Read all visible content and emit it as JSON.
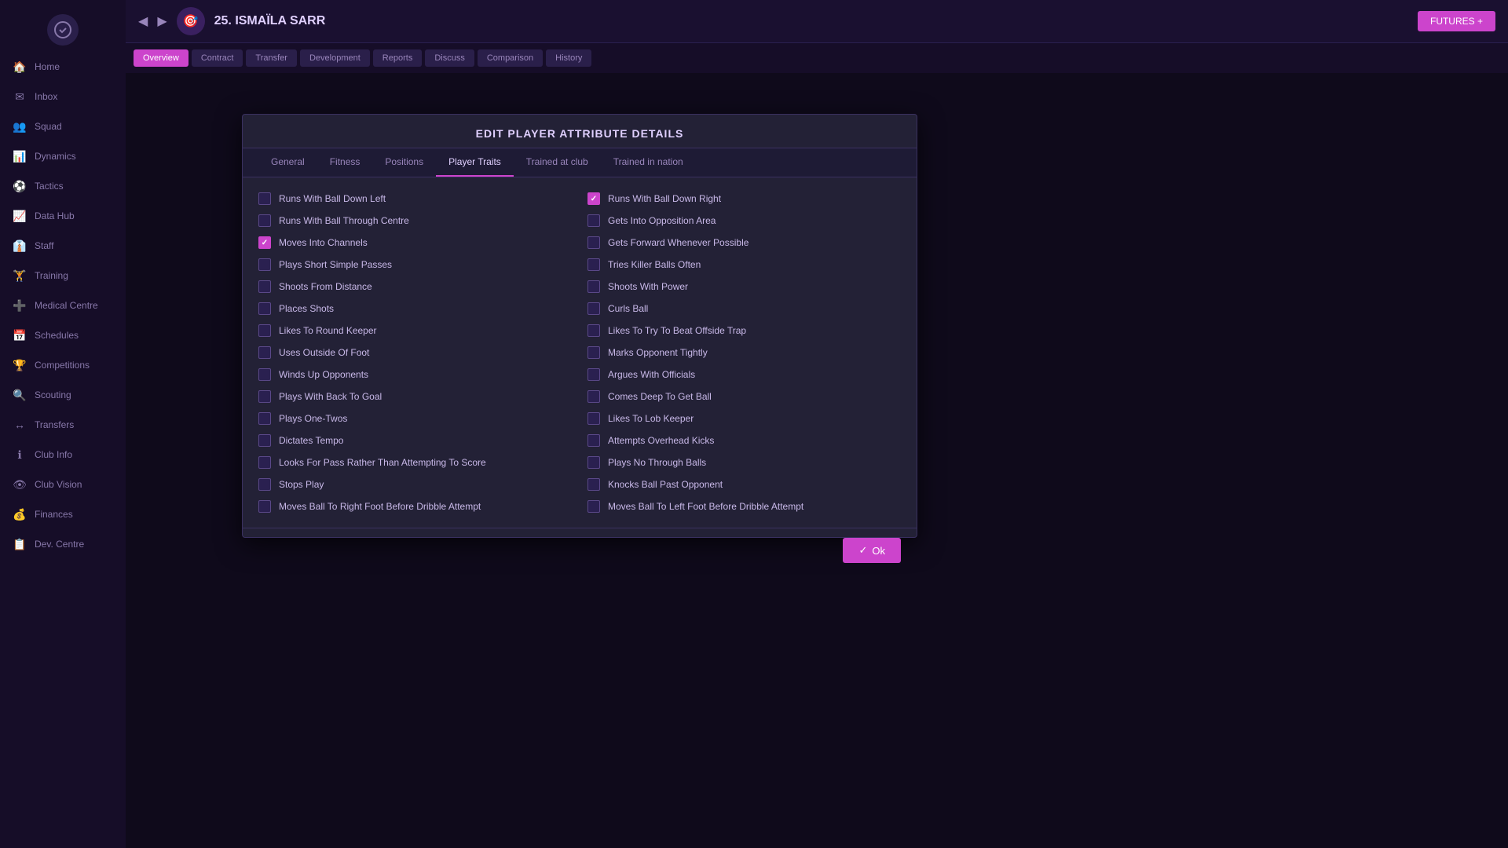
{
  "modal": {
    "title": "EDIT PLAYER ATTRIBUTE DETAILS",
    "ok_label": "Ok"
  },
  "tabs": [
    {
      "id": "general",
      "label": "General",
      "active": false
    },
    {
      "id": "fitness",
      "label": "Fitness",
      "active": false
    },
    {
      "id": "positions",
      "label": "Positions",
      "active": false
    },
    {
      "id": "player_traits",
      "label": "Player Traits",
      "active": true
    },
    {
      "id": "trained_at_club",
      "label": "Trained at club",
      "active": false
    },
    {
      "id": "trained_in_nation",
      "label": "Trained in nation",
      "active": false
    }
  ],
  "left_traits": [
    {
      "label": "Runs With Ball Down Left",
      "checked": false
    },
    {
      "label": "Runs With Ball Through Centre",
      "checked": false
    },
    {
      "label": "Moves Into Channels",
      "checked": true
    },
    {
      "label": "Plays Short Simple Passes",
      "checked": false
    },
    {
      "label": "Shoots From Distance",
      "checked": false
    },
    {
      "label": "Places Shots",
      "checked": false
    },
    {
      "label": "Likes To Round Keeper",
      "checked": false
    },
    {
      "label": "Uses Outside Of Foot",
      "checked": false
    },
    {
      "label": "Winds Up Opponents",
      "checked": false
    },
    {
      "label": "Plays With Back To Goal",
      "checked": false
    },
    {
      "label": "Plays One-Twos",
      "checked": false
    },
    {
      "label": "Dictates Tempo",
      "checked": false
    },
    {
      "label": "Looks For Pass Rather Than Attempting To Score",
      "checked": false
    },
    {
      "label": "Stops Play",
      "checked": false
    },
    {
      "label": "Moves Ball To Right Foot Before Dribble Attempt",
      "checked": false
    }
  ],
  "right_traits": [
    {
      "label": "Runs With Ball Down Right",
      "checked": true
    },
    {
      "label": "Gets Into Opposition Area",
      "checked": false
    },
    {
      "label": "Gets Forward Whenever Possible",
      "checked": false
    },
    {
      "label": "Tries Killer Balls Often",
      "checked": false
    },
    {
      "label": "Shoots With Power",
      "checked": false
    },
    {
      "label": "Curls Ball",
      "checked": false
    },
    {
      "label": "Likes To Try To Beat Offside Trap",
      "checked": false
    },
    {
      "label": "Marks Opponent Tightly",
      "checked": false
    },
    {
      "label": "Argues With Officials",
      "checked": false
    },
    {
      "label": "Comes Deep To Get Ball",
      "checked": false
    },
    {
      "label": "Likes To Lob Keeper",
      "checked": false
    },
    {
      "label": "Attempts Overhead Kicks",
      "checked": false
    },
    {
      "label": "Plays No Through Balls",
      "checked": false
    },
    {
      "label": "Knocks Ball Past Opponent",
      "checked": false
    },
    {
      "label": "Moves Ball To Left Foot Before Dribble Attempt",
      "checked": false
    }
  ],
  "sidebar": {
    "items": [
      {
        "label": "Home",
        "icon": "🏠"
      },
      {
        "label": "Inbox",
        "icon": "✉"
      },
      {
        "label": "Squad",
        "icon": "👥"
      },
      {
        "label": "Dynamics",
        "icon": "📊"
      },
      {
        "label": "Tactics",
        "icon": "⚽"
      },
      {
        "label": "Data Hub",
        "icon": "📈"
      },
      {
        "label": "Staff",
        "icon": "👔"
      },
      {
        "label": "Training",
        "icon": "🏋"
      },
      {
        "label": "Medical Centre",
        "icon": "➕"
      },
      {
        "label": "Schedules",
        "icon": "📅"
      },
      {
        "label": "Competitions",
        "icon": "🏆"
      },
      {
        "label": "Scouting",
        "icon": "🔍"
      },
      {
        "label": "Transfers",
        "icon": "↔"
      },
      {
        "label": "Club Info",
        "icon": "ℹ"
      },
      {
        "label": "Club Vision",
        "icon": "👁"
      },
      {
        "label": "Finances",
        "icon": "💰"
      },
      {
        "label": "Dev. Centre",
        "icon": "📋"
      }
    ]
  },
  "topbar": {
    "player_name": "25. ISMAÏLA SARR",
    "futures_label": "FUTURES +"
  },
  "navbar": {
    "buttons": [
      "Overview",
      "Contract",
      "Transfer",
      "Development",
      "Reports",
      "Discuss",
      "Comparison",
      "History"
    ]
  }
}
